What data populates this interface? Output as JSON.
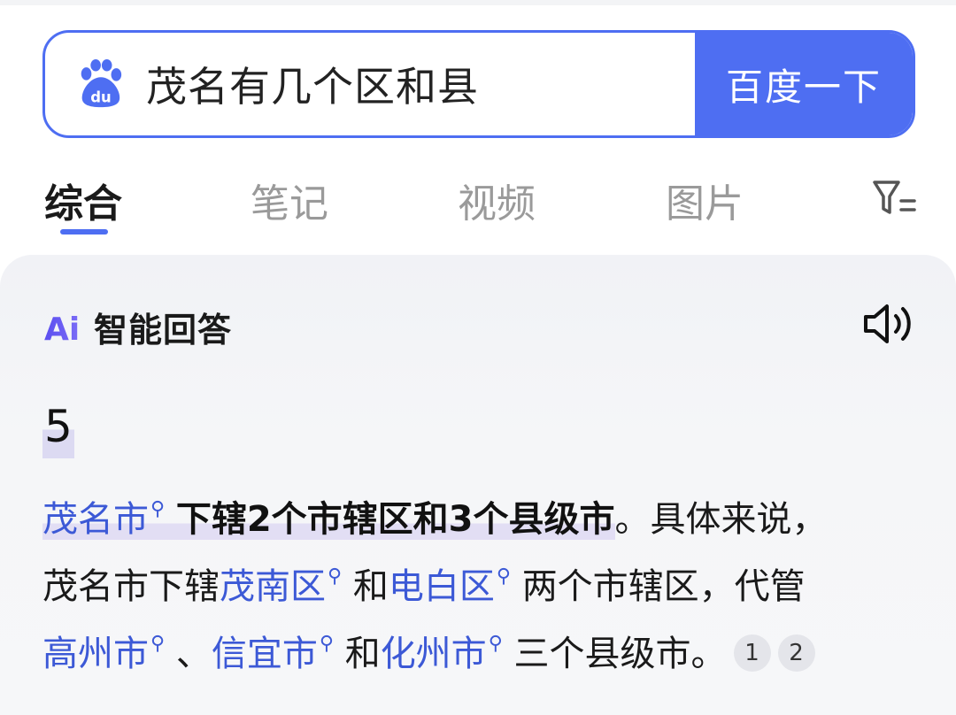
{
  "search": {
    "query": "茂名有几个区和县",
    "button_label": "百度一下",
    "logo_text": "du"
  },
  "tabs": [
    {
      "label": "综合",
      "active": true
    },
    {
      "label": "笔记",
      "active": false
    },
    {
      "label": "视频",
      "active": false
    },
    {
      "label": "图片",
      "active": false
    }
  ],
  "ai_card": {
    "badge": "Ai",
    "title": "智能回答",
    "answer": "5",
    "line1": {
      "link": "茂名市",
      "bold": "下辖2个市辖区和3个县级市",
      "rest": "。具体来说，"
    },
    "line2": {
      "t1": "茂名市下辖",
      "link1": "茂南区",
      "t2": "和",
      "link2": "电白区",
      "t3": "两个市辖区，代管"
    },
    "line3": {
      "link1": "高州市",
      "t1": "、",
      "link2": "信宜市",
      "t2": "和",
      "link3": "化州市",
      "t3": "三个县级市。"
    },
    "citations": [
      "1",
      "2"
    ]
  },
  "colors": {
    "brand_blue": "#4e6ef2",
    "link_blue": "#3c59d6",
    "highlight": "#e2def4"
  }
}
